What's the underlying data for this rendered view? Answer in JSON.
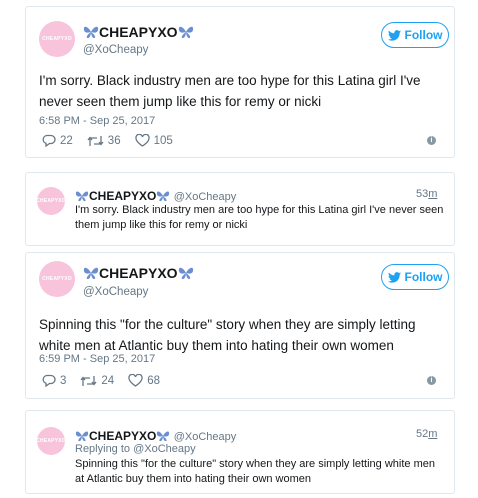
{
  "colors": {
    "accent": "#1da1f2",
    "avatar": "#f7c4dc",
    "muted": "#657786",
    "border": "#e1e8ed"
  },
  "avatar_text": "CHEAPYXO",
  "card1": {
    "name": "CHEAPYXO",
    "handle": "@XoCheapy",
    "follow_label": "Follow",
    "text": "I'm sorry. Black industry men are too hype for this Latina girl I've never seen them jump like this for remy or nicki",
    "timestamp": "6:58 PM - Sep 25, 2017",
    "replies": "22",
    "retweets": "36",
    "likes": "105"
  },
  "card2": {
    "name": "CHEAPYXO",
    "handle": "@XoCheapy",
    "ago_num": "53",
    "ago_unit": "m",
    "text": "I'm sorry. Black industry men are too hype for this Latina girl I've never seen them jump like this for remy or nicki"
  },
  "card3": {
    "name": "CHEAPYXO",
    "handle": "@XoCheapy",
    "follow_label": "Follow",
    "text": "Spinning this \"for the culture\" story when they are simply letting white men at Atlantic buy them into hating their own women",
    "timestamp": "6:59 PM - Sep 25, 2017",
    "replies": "3",
    "retweets": "24",
    "likes": "68"
  },
  "card4": {
    "name": "CHEAPYXO",
    "handle": "@XoCheapy",
    "ago_num": "52",
    "ago_unit": "m",
    "replying_to": "Replying to @XoCheapy",
    "text": "Spinning this \"for the culture\" story when they are simply letting white men at Atlantic buy them into hating their own women"
  }
}
